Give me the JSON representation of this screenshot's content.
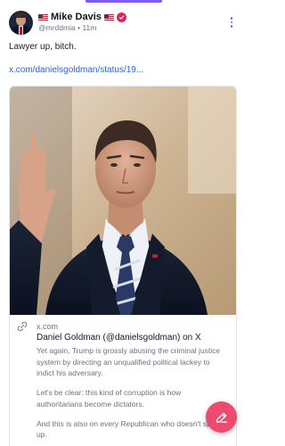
{
  "post": {
    "author_name": "Mike Davis",
    "handle": "@mrddmia",
    "separator": "•",
    "time_ago": "11m",
    "text": "Lawyer up, bitch.",
    "link_text": "x.com/danielsgoldman/status/19..."
  },
  "card": {
    "domain": "x.com",
    "title": "Daniel Goldman (@danielsgoldman) on X",
    "description": [
      "Yet again, Trump is grossly abusing the criminal justice system by directing an unqualified political lackey to indict his adversary.",
      "Let's be clear: this kind of corruption is how authoritarians become dictators.",
      "And this is also on every Republican who doesn't speak up."
    ]
  },
  "icons": {
    "flag": "us-flag-icon",
    "verified": "verified-badge-icon",
    "more": "more-options-icon",
    "link": "link-icon",
    "compose": "compose-icon"
  },
  "colors": {
    "accent": "#7c5cf5",
    "fab": "#ec4b6e",
    "link": "#2563eb",
    "badge": "#e0245e"
  }
}
